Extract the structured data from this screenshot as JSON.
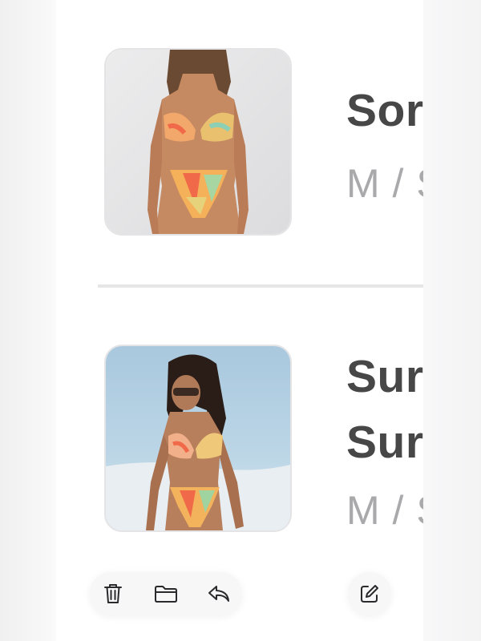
{
  "products": [
    {
      "title": "Sor",
      "variant": "M / S",
      "image": "bikini-photo-studio"
    },
    {
      "title_line1": "Sur",
      "title_line2": "Sur",
      "variant": "M / S",
      "image": "bikini-photo-beach"
    }
  ],
  "toolbar": {
    "icons": [
      "trash-icon",
      "folder-icon",
      "reply-icon"
    ],
    "compose_icon": "compose-icon"
  },
  "colors": {
    "title": "#474748",
    "variant": "#a9a9ab",
    "divider": "#e6e6e7"
  }
}
